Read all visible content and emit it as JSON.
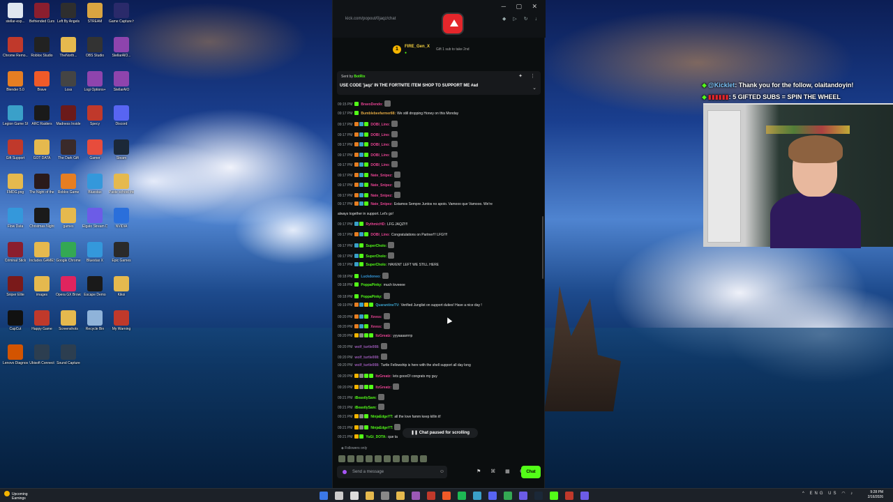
{
  "desktop": {
    "icons": [
      {
        "label": "stellar-exp...",
        "color": "#dfe6f0"
      },
      {
        "label": "Befriended Curse",
        "color": "#8b1e2e"
      },
      {
        "label": "Left By Angels",
        "color": "#2e2e2e"
      },
      {
        "label": "STREAM",
        "color": "#d9a441"
      },
      {
        "label": "Game Capture HD",
        "color": "#2a2a6a"
      },
      {
        "label": "Chrome Remo...",
        "color": "#c0392b"
      },
      {
        "label": "Roblox Studio",
        "color": "#222222"
      },
      {
        "label": "TheNorth...",
        "color": "#e5b94e"
      },
      {
        "label": "OBS Studio",
        "color": "#333333"
      },
      {
        "label": "StellarAIO...",
        "color": "#8e44ad"
      },
      {
        "label": "Blender 5.0",
        "color": "#e67e22"
      },
      {
        "label": "Brave",
        "color": "#f05a28"
      },
      {
        "label": "Loss",
        "color": "#444444"
      },
      {
        "label": "Logi Options+",
        "color": "#8e44ad"
      },
      {
        "label": "StellarAIO",
        "color": "#8e44ad"
      },
      {
        "label": "Legion Game Shop",
        "color": "#3aa0c9"
      },
      {
        "label": "ARC Raiders",
        "color": "#1a1a1a"
      },
      {
        "label": "Madness Inside",
        "color": "#6b1a1a"
      },
      {
        "label": "Specy",
        "color": "#c0392b"
      },
      {
        "label": "Discord",
        "color": "#5865f2"
      },
      {
        "label": "Gift Support",
        "color": "#c0392b"
      },
      {
        "label": "GOT DATA",
        "color": "#e5b94e"
      },
      {
        "label": "The Dark Gift",
        "color": "#3a2a2a"
      },
      {
        "label": "Gamer",
        "color": "#e74c3c"
      },
      {
        "label": "Steam",
        "color": "#1b2838"
      },
      {
        "label": "FMDG.png",
        "color": "#e5b94e"
      },
      {
        "label": "The Night of the Scissors",
        "color": "#2a1a1a"
      },
      {
        "label": "Roblox Game",
        "color": "#e67e22"
      },
      {
        "label": "Bluestax",
        "color": "#3498db"
      },
      {
        "label": "Paste school things",
        "color": "#e5b94e"
      },
      {
        "label": "Flow Data",
        "color": "#3498db"
      },
      {
        "label": "Christmas Night",
        "color": "#1a1a1a"
      },
      {
        "label": "games",
        "color": "#e5b94e"
      },
      {
        "label": "Elgato Stream Deck",
        "color": "#6c5ce7"
      },
      {
        "label": "NVIDIA",
        "color": "#2a6fdb"
      },
      {
        "label": "Criminal Stick",
        "color": "#8b1e2e"
      },
      {
        "label": "Includes GAMES",
        "color": "#e5b94e"
      },
      {
        "label": "Google Chrome",
        "color": "#34a853"
      },
      {
        "label": "Bluestax X",
        "color": "#3498db"
      },
      {
        "label": "Epic Games",
        "color": "#2a2a2a"
      },
      {
        "label": "Sniper Elite",
        "color": "#7a1a1a"
      },
      {
        "label": "images",
        "color": "#e5b94e"
      },
      {
        "label": "Opera GX Browser",
        "color": "#e0245e"
      },
      {
        "label": "Escape Demo",
        "color": "#1a1a1a"
      },
      {
        "label": "Kikoi",
        "color": "#e5b94e"
      },
      {
        "label": "CapCut",
        "color": "#111111"
      },
      {
        "label": "Happy Game",
        "color": "#c0392b"
      },
      {
        "label": "Screenshots",
        "color": "#e5b94e"
      },
      {
        "label": "Recycle Bin",
        "color": "#8fb3d9"
      },
      {
        "label": "My Warning",
        "color": "#c0392b"
      },
      {
        "label": "Lenovo Diagnostics",
        "color": "#d35400"
      },
      {
        "label": "Ubisoft Connect",
        "color": "#2c3e50"
      },
      {
        "label": "Sound Capture",
        "color": "#2c3e50"
      }
    ]
  },
  "chat_window": {
    "url": "kick.com/popout/0jaqz/chat",
    "gifter": {
      "rank": "1",
      "name": "FIRE_Gen_X",
      "note": "Gift 1 sub to take 2nd"
    },
    "pinned": {
      "sent_by_prefix": "Sent by",
      "sent_by_user": "BotRix",
      "message": "USE CODE 'jaqz' IN THE FORTNITE ITEM SHOP TO SUPPORT ME #ad"
    },
    "messages": [
      {
        "time": "09:15 PM",
        "user": "BravoDendo:",
        "user_color": "#e84393",
        "text": "",
        "emote": true,
        "badges": [
          "#53fc18"
        ]
      },
      {
        "time": "09:17 PM",
        "user": "Bumblebeefarmer88:",
        "user_color": "#e1a843",
        "text": "We still dropping Honey on this Monday",
        "emote": false,
        "badges": [
          "#53fc18"
        ]
      },
      {
        "time": "09:17 PM",
        "user": "DOBI_Lino:",
        "user_color": "#e84393",
        "text": "",
        "emote": true,
        "badges": [
          "#e67e22",
          "#3aa0c9",
          "#53fc18"
        ]
      },
      {
        "time": "09:17 PM",
        "user": "DOBI_Lino:",
        "user_color": "#e84393",
        "text": "",
        "emote": true,
        "badges": [
          "#e67e22",
          "#3aa0c9",
          "#53fc18"
        ]
      },
      {
        "time": "09:17 PM",
        "user": "DOBI_Lino:",
        "user_color": "#e84393",
        "text": "",
        "emote": true,
        "badges": [
          "#e67e22",
          "#3aa0c9",
          "#53fc18"
        ]
      },
      {
        "time": "09:17 PM",
        "user": "DOBI_Lino:",
        "user_color": "#e84393",
        "text": "",
        "emote": true,
        "badges": [
          "#e67e22",
          "#3aa0c9",
          "#53fc18"
        ]
      },
      {
        "time": "09:17 PM",
        "user": "DOBI_Lino:",
        "user_color": "#e84393",
        "text": "",
        "emote": true,
        "badges": [
          "#e67e22",
          "#3aa0c9",
          "#53fc18"
        ]
      },
      {
        "time": "09:17 PM",
        "user": "Nate_Snipez:",
        "user_color": "#e84393",
        "text": "",
        "emote": true,
        "badges": [
          "#e67e22",
          "#3aa0c9",
          "#53fc18"
        ]
      },
      {
        "time": "09:17 PM",
        "user": "Nate_Snipez:",
        "user_color": "#e84393",
        "text": "",
        "emote": true,
        "badges": [
          "#e67e22",
          "#3aa0c9",
          "#53fc18"
        ]
      },
      {
        "time": "09:17 PM",
        "user": "Nate_Snipez:",
        "user_color": "#e84393",
        "text": "",
        "emote": true,
        "badges": [
          "#e67e22",
          "#3aa0c9",
          "#53fc18"
        ]
      },
      {
        "time": "09:17 PM",
        "user": "Nate_Snipez:",
        "user_color": "#e84393",
        "text": "Estamos Sempre Juntos no apoio. Vamooo que Vamooo. We're",
        "emote": false,
        "badges": [
          "#e67e22",
          "#3aa0c9",
          "#53fc18"
        ]
      },
      {
        "time": "",
        "user": "",
        "user_color": "#e6e6e6",
        "text": "always together in support. Let's go!",
        "emote": false,
        "badges": []
      },
      {
        "time": "09:17 PM",
        "user": "RythmicHD:",
        "user_color": "#e84393",
        "text": "LFG JAQZ!!!!",
        "emote": false,
        "badges": [
          "#3aa0c9",
          "#53fc18"
        ]
      },
      {
        "time": "09:17 PM",
        "user": "DOBI_Lino:",
        "user_color": "#e84393",
        "text": "Congratulations on Partner!!! LFG!!!!",
        "emote": false,
        "badges": [
          "#e67e22",
          "#3aa0c9",
          "#53fc18"
        ]
      },
      {
        "time": "09:17 PM",
        "user": "SuperCholo:",
        "user_color": "#53fc18",
        "text": "",
        "emote": true,
        "badges": [
          "#3aa0c9",
          "#53fc18"
        ]
      },
      {
        "time": "09:17 PM",
        "user": "SuperCholo:",
        "user_color": "#53fc18",
        "text": "",
        "emote": true,
        "badges": [
          "#3aa0c9",
          "#53fc18"
        ]
      },
      {
        "time": "09:17 PM",
        "user": "SuperCholo:",
        "user_color": "#53fc18",
        "text": "HAVENT LEFT WE STILL HERE",
        "emote": false,
        "badges": [
          "#3aa0c9",
          "#53fc18"
        ]
      },
      {
        "time": "09:18 PM",
        "user": "Luckdoneo:",
        "user_color": "#3498db",
        "text": "",
        "emote": true,
        "badges": [
          "#53fc18"
        ]
      },
      {
        "time": "09:18 PM",
        "user": "PoppaPinky:",
        "user_color": "#53fc18",
        "text": "much loveeee",
        "emote": false,
        "badges": [
          "#53fc18"
        ]
      },
      {
        "time": "09:18 PM",
        "user": "PoppaPinky:",
        "user_color": "#53fc18",
        "text": "",
        "emote": true,
        "badges": [
          "#53fc18"
        ]
      },
      {
        "time": "09:19 PM",
        "user": "QuarantineTV:",
        "user_color": "#3aa0c9",
        "text": "Verified Junglist on support duties! Have a nice day !",
        "emote": false,
        "badges": [
          "#e67e22",
          "#3aa0c9",
          "#f4b400",
          "#53fc18"
        ]
      },
      {
        "time": "09:20 PM",
        "user": "Xevss:",
        "user_color": "#e84393",
        "text": "",
        "emote": true,
        "badges": [
          "#e67e22",
          "#3aa0c9",
          "#53fc18"
        ]
      },
      {
        "time": "09:20 PM",
        "user": "Xevss:",
        "user_color": "#e84393",
        "text": "",
        "emote": true,
        "badges": [
          "#e67e22",
          "#3aa0c9",
          "#53fc18"
        ]
      },
      {
        "time": "09:20 PM",
        "user": "ItzGreatz:",
        "user_color": "#e84393",
        "text": "yyyaaaarrrrp",
        "emote": false,
        "badges": [
          "#f4b400",
          "#888888",
          "#53fc18",
          "#53fc18"
        ]
      },
      {
        "time": "09:20 PM",
        "user": "wolf_turtle008:",
        "user_color": "#9b59b6",
        "text": "",
        "emote": true,
        "badges": []
      },
      {
        "time": "09:20 PM",
        "user": "wolf_turtle008:",
        "user_color": "#9b59b6",
        "text": "",
        "emote": true,
        "badges": []
      },
      {
        "time": "09:20 PM",
        "user": "wolf_turtle008:",
        "user_color": "#9b59b6",
        "text": "Turtle Fellowship is here with the shell support all day long",
        "emote": false,
        "badges": []
      },
      {
        "time": "09:20 PM",
        "user": "ItzGreatz:",
        "user_color": "#e84393",
        "text": "lets goooO! congrats my guy",
        "emote": false,
        "badges": [
          "#f4b400",
          "#888888",
          "#53fc18",
          "#53fc18"
        ]
      },
      {
        "time": "09:20 PM",
        "user": "ItzGreatz:",
        "user_color": "#e84393",
        "text": "",
        "emote": true,
        "badges": [
          "#f4b400",
          "#888888",
          "#53fc18",
          "#53fc18"
        ]
      },
      {
        "time": "09:21 PM",
        "user": "iBeastlySam:",
        "user_color": "#53fc18",
        "text": "",
        "emote": true,
        "badges": []
      },
      {
        "time": "09:21 PM",
        "user": "iBeastlySam:",
        "user_color": "#53fc18",
        "text": "",
        "emote": true,
        "badges": []
      },
      {
        "time": "09:21 PM",
        "user": "NinjaEdgeYT:",
        "user_color": "#53fc18",
        "text": "all the love famm keep killin it!",
        "emote": false,
        "badges": [
          "#f4b400",
          "#888888",
          "#53fc18"
        ]
      },
      {
        "time": "09:21 PM",
        "user": "NinjaEdgeYT:",
        "user_color": "#53fc18",
        "text": "",
        "emote": true,
        "badges": [
          "#f4b400",
          "#888888",
          "#53fc18"
        ]
      },
      {
        "time": "09:21 PM",
        "user": "YuGi_DOTA:",
        "user_color": "#53fc18",
        "text": "que ta",
        "emote": false,
        "badges": [
          "#f4b400",
          "#53fc18"
        ]
      }
    ],
    "paused_label": "Chat paused for scrolling",
    "followers_only_label": "Followers only",
    "input_placeholder": "Send a message",
    "send_label": "Chat"
  },
  "overlay": {
    "alerts": [
      {
        "user": "@Kicklet",
        "text": ": Thank you for the follow, olaitandoyin!"
      },
      {
        "user": "▮▮▮▮▮▮",
        "text": ": 5 GIFTED SUBS = SPIN THE WHEEL"
      }
    ]
  },
  "taskbar": {
    "weather_title": "Upcoming",
    "weather_sub": "Earnings",
    "clock_time": "9:28 PM",
    "clock_date": "2/16/2026",
    "lang": "ENG US",
    "app_colors": [
      "#3b78e7",
      "#cccccc",
      "#dddddd",
      "#e5b94e",
      "#888888",
      "#e5b94e",
      "#9b59b6",
      "#c0392b",
      "#f05a28",
      "#1db954",
      "#3aa0c9",
      "#5865f2",
      "#34a853",
      "#6c5ce7",
      "#1b2838",
      "#53fc18",
      "#c0392b",
      "#6c5ce7"
    ]
  }
}
